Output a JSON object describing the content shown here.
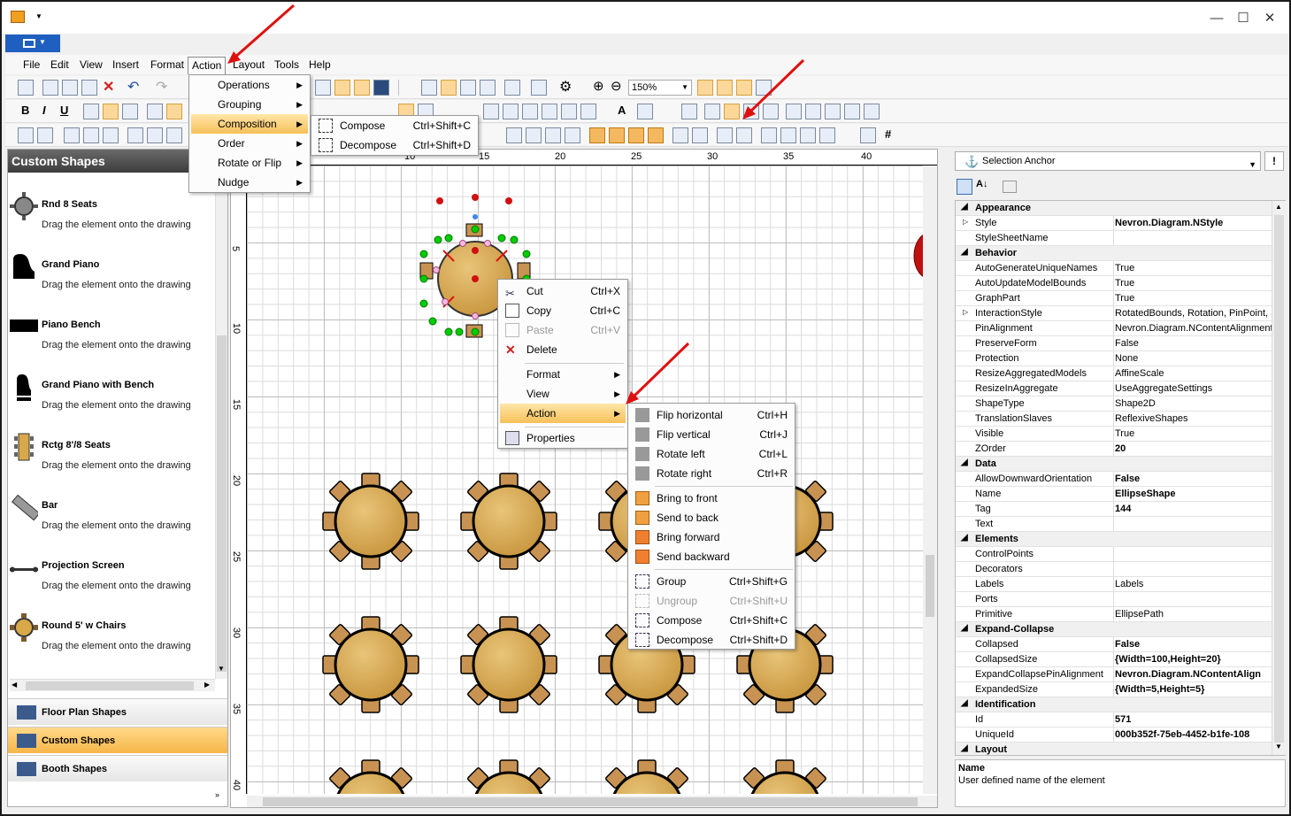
{
  "titlebar": {
    "minimize": "—",
    "maximize": "☐",
    "close": "✕"
  },
  "menubar": [
    "File",
    "Edit",
    "View",
    "Insert",
    "Format",
    "Action",
    "Layout",
    "Tools",
    "Help"
  ],
  "toolbar": {
    "zoom": "150%",
    "bold": "B",
    "italic": "I",
    "underline": "U"
  },
  "left_panel": {
    "title": "Custom Shapes",
    "shapes": [
      {
        "name": "Rnd 8 Seats",
        "desc": "Drag the element onto the drawing"
      },
      {
        "name": "Grand Piano",
        "desc": "Drag the element onto the drawing"
      },
      {
        "name": "Piano Bench",
        "desc": "Drag the element onto the drawing"
      },
      {
        "name": "Grand Piano with Bench",
        "desc": "Drag the element onto the drawing"
      },
      {
        "name": "Rctg 8'/8 Seats",
        "desc": "Drag the element onto the drawing"
      },
      {
        "name": "Bar",
        "desc": "Drag the element onto the drawing"
      },
      {
        "name": "Projection Screen",
        "desc": "Drag the element onto the drawing"
      },
      {
        "name": "Round 5' w Chairs",
        "desc": "Drag the element onto the drawing"
      }
    ],
    "categories": [
      "Floor Plan Shapes",
      "Custom Shapes",
      "Booth Shapes"
    ]
  },
  "ruler": {
    "top": [
      "10",
      "15",
      "20",
      "25",
      "30",
      "35",
      "40"
    ],
    "left": [
      "5",
      "10",
      "15",
      "20",
      "25",
      "30",
      "35",
      "40"
    ]
  },
  "action_menu": {
    "items": [
      "Operations",
      "Grouping",
      "Composition",
      "Order",
      "Rotate or Flip",
      "Nudge"
    ]
  },
  "composition_submenu": [
    {
      "label": "Compose",
      "shortcut": "Ctrl+Shift+C"
    },
    {
      "label": "Decompose",
      "shortcut": "Ctrl+Shift+D"
    }
  ],
  "context_menu": [
    {
      "label": "Cut",
      "shortcut": "Ctrl+X"
    },
    {
      "label": "Copy",
      "shortcut": "Ctrl+C"
    },
    {
      "label": "Paste",
      "shortcut": "Ctrl+V"
    },
    {
      "label": "Delete",
      "shortcut": ""
    },
    {
      "label": "Format",
      "shortcut": ""
    },
    {
      "label": "View",
      "shortcut": ""
    },
    {
      "label": "Action",
      "shortcut": ""
    },
    {
      "label": "Properties",
      "shortcut": ""
    }
  ],
  "action_submenu": [
    {
      "label": "Flip horizontal",
      "shortcut": "Ctrl+H"
    },
    {
      "label": "Flip vertical",
      "shortcut": "Ctrl+J"
    },
    {
      "label": "Rotate left",
      "shortcut": "Ctrl+L"
    },
    {
      "label": "Rotate right",
      "shortcut": "Ctrl+R"
    },
    {
      "label": "Bring to front",
      "shortcut": ""
    },
    {
      "label": "Send to back",
      "shortcut": ""
    },
    {
      "label": "Bring forward",
      "shortcut": ""
    },
    {
      "label": "Send backward",
      "shortcut": ""
    },
    {
      "label": "Group",
      "shortcut": "Ctrl+Shift+G"
    },
    {
      "label": "Ungroup",
      "shortcut": "Ctrl+Shift+U"
    },
    {
      "label": "Compose",
      "shortcut": "Ctrl+Shift+C"
    },
    {
      "label": "Decompose",
      "shortcut": "Ctrl+Shift+D"
    }
  ],
  "right_panel": {
    "anchor": "Selection Anchor",
    "properties": [
      {
        "cat": "Appearance"
      },
      {
        "name": "Style",
        "value": "Nevron.Diagram.NStyle",
        "bold": true,
        "exp": true
      },
      {
        "name": "StyleSheetName",
        "value": ""
      },
      {
        "cat": "Behavior"
      },
      {
        "name": "AutoGenerateUniqueNames",
        "value": "True"
      },
      {
        "name": "AutoUpdateModelBounds",
        "value": "True"
      },
      {
        "name": "GraphPart",
        "value": "True"
      },
      {
        "name": "InteractionStyle",
        "value": "RotatedBounds, Rotation, PinPoint, S",
        "exp": true
      },
      {
        "name": "PinAlignment",
        "value": "Nevron.Diagram.NContentAlignment"
      },
      {
        "name": "PreserveForm",
        "value": "False"
      },
      {
        "name": "Protection",
        "value": "None"
      },
      {
        "name": "ResizeAggregatedModels",
        "value": "AffineScale"
      },
      {
        "name": "ResizeInAggregate",
        "value": "UseAggregateSettings"
      },
      {
        "name": "ShapeType",
        "value": "Shape2D"
      },
      {
        "name": "TranslationSlaves",
        "value": "ReflexiveShapes"
      },
      {
        "name": "Visible",
        "value": "True"
      },
      {
        "name": "ZOrder",
        "value": "20",
        "bold": true
      },
      {
        "cat": "Data"
      },
      {
        "name": "AllowDownwardOrientation",
        "value": "False",
        "bold": true
      },
      {
        "name": "Name",
        "value": "EllipseShape",
        "bold": true
      },
      {
        "name": "Tag",
        "value": "144",
        "bold": true
      },
      {
        "name": "Text",
        "value": ""
      },
      {
        "cat": "Elements"
      },
      {
        "name": "ControlPoints",
        "value": ""
      },
      {
        "name": "Decorators",
        "value": ""
      },
      {
        "name": "Labels",
        "value": "Labels"
      },
      {
        "name": "Ports",
        "value": ""
      },
      {
        "name": "Primitive",
        "value": "EllipsePath"
      },
      {
        "cat": "Expand-Collapse"
      },
      {
        "name": "Collapsed",
        "value": "False",
        "bold": true
      },
      {
        "name": "CollapsedSize",
        "value": "{Width=100,Height=20}",
        "bold": true
      },
      {
        "name": "ExpandCollapsePinAlignment",
        "value": "Nevron.Diagram.NContentAlign",
        "bold": true
      },
      {
        "name": "ExpandedSize",
        "value": "{Width=5,Height=5}",
        "bold": true
      },
      {
        "cat": "Identification"
      },
      {
        "name": "Id",
        "value": "571",
        "bold": true
      },
      {
        "name": "UniqueId",
        "value": "000b352f-75eb-4452-b1fe-108",
        "bold": true
      },
      {
        "cat": "Layout"
      }
    ],
    "desc_title": "Name",
    "desc_text": "User defined name of the element"
  },
  "colors": {
    "accent": "#1f5fbf",
    "highlight": "#f7c05a",
    "table": "#d9a849",
    "chair": "#c89352",
    "arrow": "#e01010"
  }
}
